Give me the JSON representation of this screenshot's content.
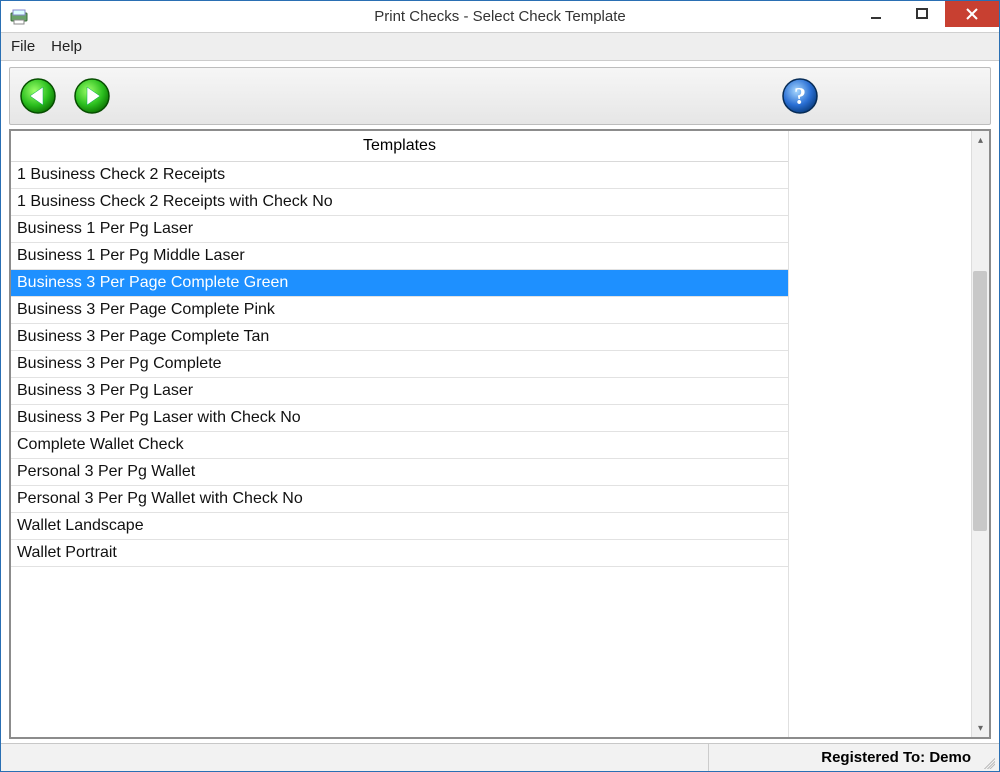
{
  "window": {
    "title": "Print Checks - Select Check Template"
  },
  "menubar": {
    "file": "File",
    "help": "Help"
  },
  "list": {
    "header": "Templates",
    "selected_index": 4,
    "items": [
      "1 Business Check 2 Receipts",
      "1 Business Check 2 Receipts with Check No",
      "Business 1 Per Pg Laser",
      "Business 1 Per Pg Middle Laser",
      "Business 3 Per Page Complete Green",
      "Business 3 Per Page Complete Pink",
      "Business 3 Per Page Complete Tan",
      "Business 3 Per Pg Complete",
      "Business 3 Per Pg Laser",
      "Business 3 Per Pg Laser with Check No",
      "Complete Wallet Check",
      "Personal 3 Per Pg Wallet",
      "Personal 3 Per Pg Wallet with Check No",
      "Wallet Landscape",
      "Wallet Portrait"
    ]
  },
  "statusbar": {
    "registered": "Registered To: Demo"
  }
}
